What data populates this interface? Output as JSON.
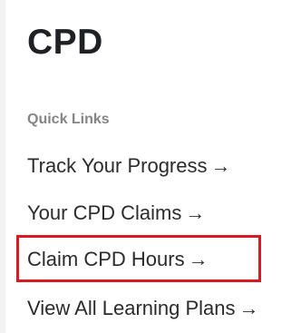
{
  "title": "CPD",
  "quick_links": {
    "label": "Quick Links",
    "items": [
      {
        "label": "Track Your Progress",
        "arrow": "→"
      },
      {
        "label": "Your CPD Claims",
        "arrow": "→"
      },
      {
        "label": "Claim CPD Hours",
        "arrow": "→"
      },
      {
        "label": "View All Learning Plans",
        "arrow": "→"
      }
    ]
  },
  "colors": {
    "highlight_border": "#d71a21",
    "section_label": "#858585",
    "text": "#2b2b2b"
  }
}
